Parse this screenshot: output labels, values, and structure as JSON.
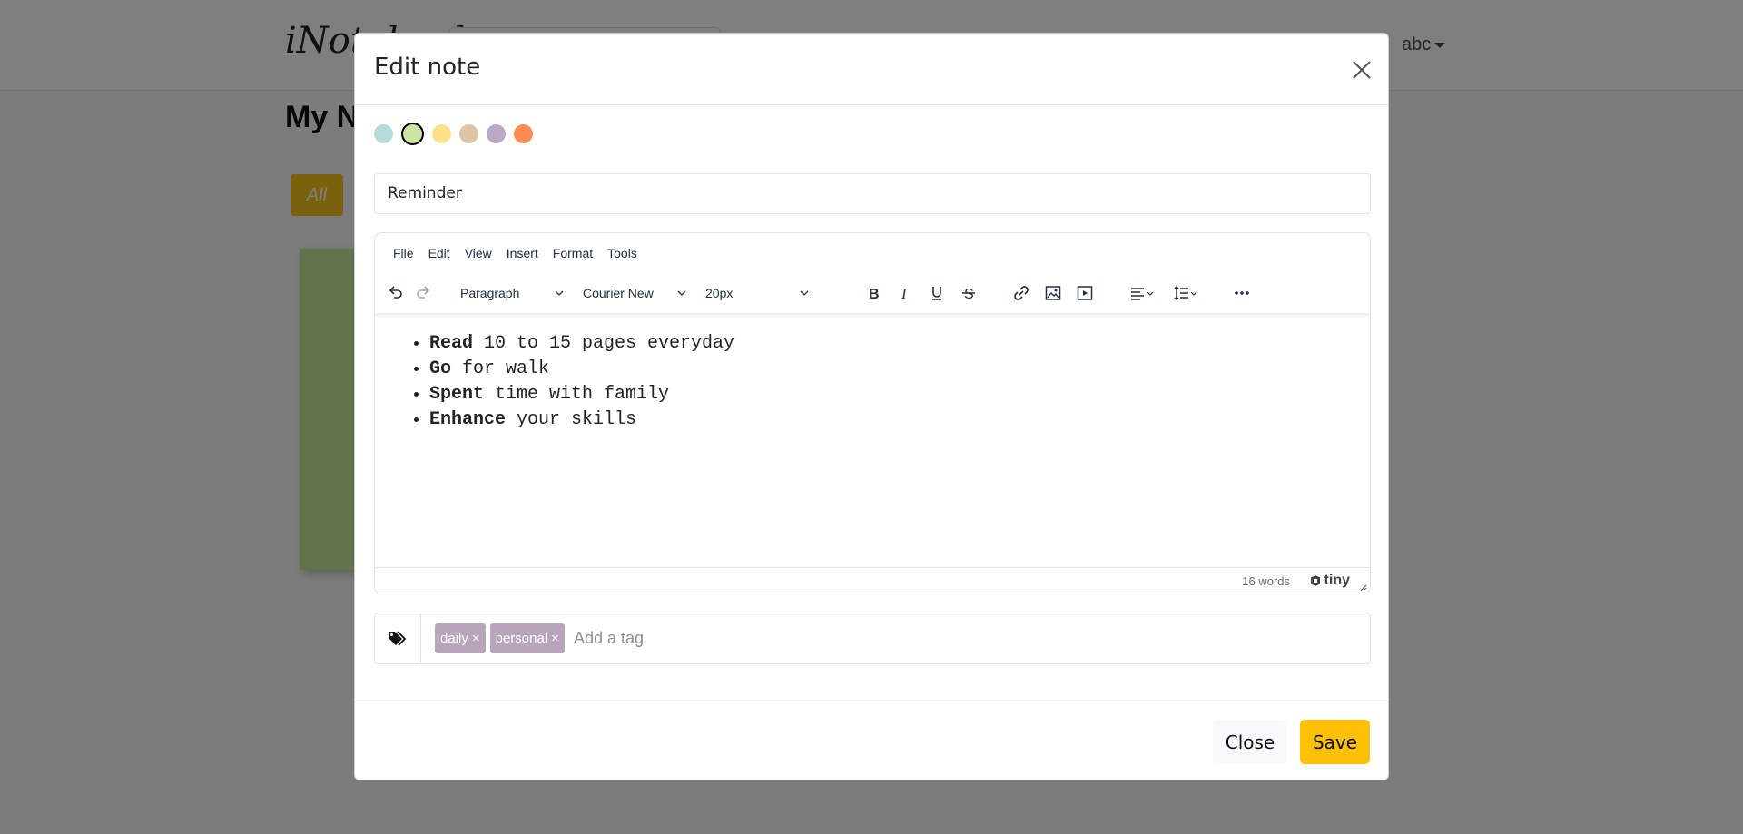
{
  "background": {
    "brand": "iNotebook",
    "user_menu": "abc",
    "page_title": "My Notes",
    "filter_all": "All"
  },
  "modal": {
    "title": "Edit note",
    "colors": [
      {
        "name": "light-blue",
        "hex": "#b7dbd9",
        "selected": false
      },
      {
        "name": "light-green",
        "hex": "#cde5a3",
        "selected": true
      },
      {
        "name": "yellow",
        "hex": "#ffe08a",
        "selected": false
      },
      {
        "name": "tan",
        "hex": "#dcc4a5",
        "selected": false
      },
      {
        "name": "lavender",
        "hex": "#baa8c4",
        "selected": false
      },
      {
        "name": "orange",
        "hex": "#ff8c55",
        "selected": false
      }
    ],
    "note_title": "Reminder",
    "editor": {
      "menu": {
        "file": "File",
        "edit": "Edit",
        "view": "View",
        "insert": "Insert",
        "format": "Format",
        "tools": "Tools"
      },
      "block_format": "Paragraph",
      "font_family": "Courier New",
      "font_size": "20px",
      "items": [
        {
          "bold": "Read",
          "rest": " 10 to 15 pages everyday"
        },
        {
          "bold": "Go",
          "rest": " for walk"
        },
        {
          "bold": "Spent",
          "rest": " time with family"
        },
        {
          "bold": "Enhance",
          "rest": " your skills"
        }
      ],
      "word_count": "16 words",
      "brand": "tiny"
    },
    "tags": [
      {
        "label": "daily",
        "remove": "×"
      },
      {
        "label": "personal",
        "remove": "×"
      }
    ],
    "tag_placeholder": "Add a tag",
    "footer": {
      "close_label": "Close",
      "save_label": "Save"
    }
  }
}
